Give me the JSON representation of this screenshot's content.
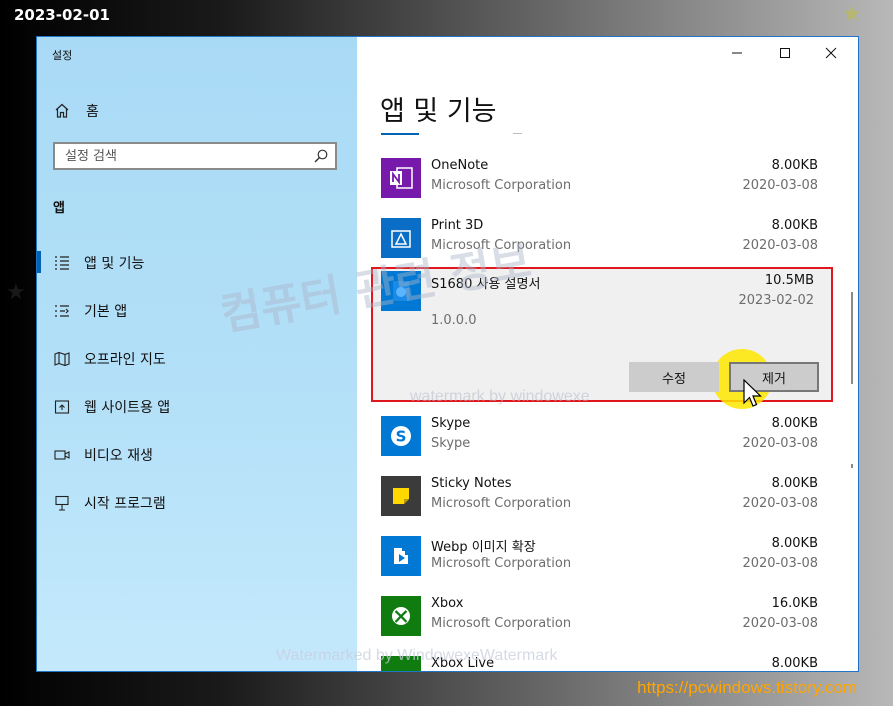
{
  "overlay": {
    "date": "2023-02-01",
    "url": "https://pcwindows.tistory.com",
    "watermark_main": "컴퓨터 관련 정보",
    "watermark_sub": "watermark by windowexe",
    "watermark_bottom": "Watermarked by WindowexeWatermark"
  },
  "window": {
    "title": "설정"
  },
  "sidebar": {
    "home_label": "홈",
    "search_placeholder": "설정 검색",
    "section": "앱",
    "items": [
      {
        "label": "앱 및 기능",
        "icon": "apps-features-icon",
        "active": true
      },
      {
        "label": "기본 앱",
        "icon": "default-apps-icon",
        "active": false
      },
      {
        "label": "오프라인 지도",
        "icon": "offline-maps-icon",
        "active": false
      },
      {
        "label": "웹 사이트용 앱",
        "icon": "websites-apps-icon",
        "active": false
      },
      {
        "label": "비디오 재생",
        "icon": "video-playback-icon",
        "active": false
      },
      {
        "label": "시작 프로그램",
        "icon": "startup-icon",
        "active": false
      }
    ]
  },
  "main": {
    "title": "앱 및 기능",
    "apps_before": [
      {
        "name": "OneNote",
        "publisher": "Microsoft Corporation",
        "size": "8.00KB",
        "date": "2020-03-08",
        "color": "#7719aa"
      },
      {
        "name": "Print 3D",
        "publisher": "Microsoft Corporation",
        "size": "8.00KB",
        "date": "2020-03-08",
        "color": "#0a6ec7"
      }
    ],
    "selected": {
      "name": "S1680 사용 설명서",
      "size": "10.5MB",
      "date": "2023-02-02",
      "version": "1.0.0.0",
      "modify_label": "수정",
      "remove_label": "제거",
      "color": "#0078d4"
    },
    "apps_after": [
      {
        "name": "Skype",
        "publisher": "Skype",
        "size": "8.00KB",
        "date": "2020-03-08",
        "color": "#0078d4"
      },
      {
        "name": "Sticky Notes",
        "publisher": "Microsoft Corporation",
        "size": "8.00KB",
        "date": "2020-03-08",
        "color": "#3b3b3b"
      },
      {
        "name": "Webp 이미지 확장",
        "publisher": "Microsoft Corporation",
        "size": "8.00KB",
        "date": "2020-03-08",
        "color": "#0078d4"
      },
      {
        "name": "Xbox",
        "publisher": "Microsoft Corporation",
        "size": "16.0KB",
        "date": "2020-03-08",
        "color": "#107c10"
      },
      {
        "name": "Xbox Live",
        "publisher": "",
        "size": "8.00KB",
        "date": "",
        "color": "#107c10"
      }
    ]
  }
}
